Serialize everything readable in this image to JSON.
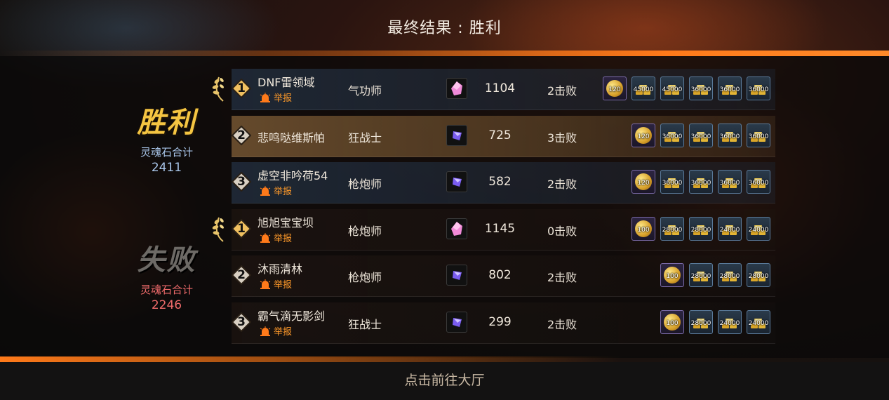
{
  "title": "最终结果 : 胜利",
  "footer": "点击前往大厅",
  "teams": {
    "win": {
      "word": "胜利",
      "label": "灵魂石合计",
      "value": "2411"
    },
    "lose": {
      "word": "失败",
      "label": "灵魂石合计",
      "value": "2246"
    }
  },
  "report_label": "举报",
  "players": [
    {
      "rank": "1",
      "name": "DNF雷领域",
      "class": "气功师",
      "item": "pink-crystal-icon",
      "score": "1104",
      "kills": "2击败",
      "soul": "120",
      "gold": [
        "45000",
        "45000",
        "36000",
        "36000",
        "36000"
      ]
    },
    {
      "rank": "2",
      "name": "悲鸣哒维斯帕",
      "class": "狂战士",
      "item": "purple-crystal-icon",
      "score": "725",
      "kills": "3击败",
      "soul": "120",
      "gold": [
        "36000",
        "36000",
        "36000",
        "36000"
      ]
    },
    {
      "rank": "3",
      "name": "虚空非吟荷54",
      "class": "枪炮师",
      "item": "purple-crystal-icon",
      "score": "582",
      "kills": "2击败",
      "soul": "120",
      "gold": [
        "36000",
        "36000",
        "36000",
        "36000"
      ]
    },
    {
      "rank": "1",
      "name": "旭旭宝宝坝",
      "class": "枪炮师",
      "item": "pink-crystal-icon",
      "score": "1145",
      "kills": "0击败",
      "soul": "100",
      "gold": [
        "28000",
        "28000",
        "24000",
        "24000"
      ]
    },
    {
      "rank": "2",
      "name": "沐雨清林",
      "class": "枪炮师",
      "item": "purple-crystal-icon",
      "score": "802",
      "kills": "2击败",
      "soul": "100",
      "gold": [
        "28000",
        "28000",
        "28000"
      ]
    },
    {
      "rank": "3",
      "name": "霸气滴无影剑",
      "class": "狂战士",
      "item": "purple-crystal-icon",
      "score": "299",
      "kills": "2击败",
      "soul": "100",
      "gold": [
        "28000",
        "24000",
        "24000"
      ]
    }
  ],
  "colors": {
    "accent": "#ff7a1a",
    "win_gold": "#f5c542",
    "report": "#ff9a2a"
  }
}
